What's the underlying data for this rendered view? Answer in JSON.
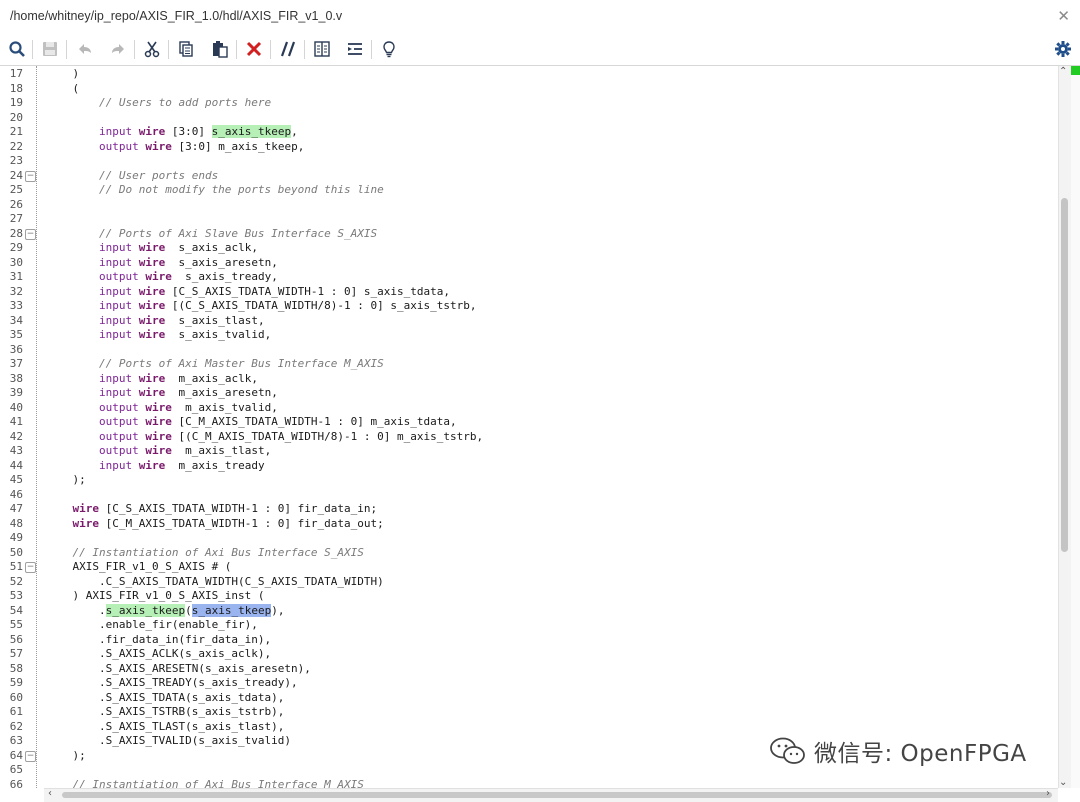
{
  "window": {
    "file_path": "/home/whitney/ip_repo/AXIS_FIR_1.0/hdl/AXIS_FIR_v1_0.v"
  },
  "toolbar": {
    "items": [
      {
        "name": "search-icon"
      },
      {
        "name": "save-icon"
      },
      {
        "name": "undo-icon"
      },
      {
        "name": "redo-icon"
      },
      {
        "name": "cut-icon"
      },
      {
        "name": "copy-icon"
      },
      {
        "name": "paste-icon"
      },
      {
        "name": "delete-icon"
      },
      {
        "name": "comment-icon"
      },
      {
        "name": "columns-icon"
      },
      {
        "name": "indent-icon"
      },
      {
        "name": "lightbulb-icon"
      },
      {
        "name": "gear-icon"
      }
    ]
  },
  "colors": {
    "keyword": "#7f2596",
    "comment": "#7a7a7a",
    "highlight": "#b6f0b6",
    "selection": "#9ab4f0",
    "marker": "#22cc22"
  },
  "editor": {
    "lines": [
      {
        "num": "17",
        "code": "    )"
      },
      {
        "num": "18",
        "code": "    ("
      },
      {
        "num": "19",
        "code": "        // Users to add ports here",
        "type": "comment"
      },
      {
        "num": "20",
        "code": ""
      },
      {
        "num": "21",
        "code": "        input wire [3:0] s_axis_tkeep,"
      },
      {
        "num": "22",
        "code": "        output wire [3:0] m_axis_tkeep,"
      },
      {
        "num": "23",
        "code": ""
      },
      {
        "num": "24",
        "code": "        // User ports ends",
        "type": "comment",
        "fold": true
      },
      {
        "num": "25",
        "code": "        // Do not modify the ports beyond this line",
        "type": "comment"
      },
      {
        "num": "26",
        "code": ""
      },
      {
        "num": "27",
        "code": ""
      },
      {
        "num": "28",
        "code": "        // Ports of Axi Slave Bus Interface S_AXIS",
        "type": "comment",
        "fold": true
      },
      {
        "num": "29",
        "code": "        input wire  s_axis_aclk,"
      },
      {
        "num": "30",
        "code": "        input wire  s_axis_aresetn,"
      },
      {
        "num": "31",
        "code": "        output wire  s_axis_tready,"
      },
      {
        "num": "32",
        "code": "        input wire [C_S_AXIS_TDATA_WIDTH-1 : 0] s_axis_tdata,"
      },
      {
        "num": "33",
        "code": "        input wire [(C_S_AXIS_TDATA_WIDTH/8)-1 : 0] s_axis_tstrb,"
      },
      {
        "num": "34",
        "code": "        input wire  s_axis_tlast,"
      },
      {
        "num": "35",
        "code": "        input wire  s_axis_tvalid,"
      },
      {
        "num": "36",
        "code": ""
      },
      {
        "num": "37",
        "code": "        // Ports of Axi Master Bus Interface M_AXIS",
        "type": "comment"
      },
      {
        "num": "38",
        "code": "        input wire  m_axis_aclk,"
      },
      {
        "num": "39",
        "code": "        input wire  m_axis_aresetn,"
      },
      {
        "num": "40",
        "code": "        output wire  m_axis_tvalid,"
      },
      {
        "num": "41",
        "code": "        output wire [C_M_AXIS_TDATA_WIDTH-1 : 0] m_axis_tdata,"
      },
      {
        "num": "42",
        "code": "        output wire [(C_M_AXIS_TDATA_WIDTH/8)-1 : 0] m_axis_tstrb,"
      },
      {
        "num": "43",
        "code": "        output wire  m_axis_tlast,"
      },
      {
        "num": "44",
        "code": "        input wire  m_axis_tready"
      },
      {
        "num": "45",
        "code": "    );"
      },
      {
        "num": "46",
        "code": ""
      },
      {
        "num": "47",
        "code": "    wire [C_S_AXIS_TDATA_WIDTH-1 : 0] fir_data_in;"
      },
      {
        "num": "48",
        "code": "    wire [C_M_AXIS_TDATA_WIDTH-1 : 0] fir_data_out;"
      },
      {
        "num": "49",
        "code": ""
      },
      {
        "num": "50",
        "code": "    // Instantiation of Axi Bus Interface S_AXIS",
        "type": "comment"
      },
      {
        "num": "51",
        "code": "    AXIS_FIR_v1_0_S_AXIS # (",
        "fold": true
      },
      {
        "num": "52",
        "code": "        .C_S_AXIS_TDATA_WIDTH(C_S_AXIS_TDATA_WIDTH)"
      },
      {
        "num": "53",
        "code": "    ) AXIS_FIR_v1_0_S_AXIS_inst ("
      },
      {
        "num": "54",
        "code": "        .s_axis_tkeep(s_axis_tkeep),"
      },
      {
        "num": "55",
        "code": "        .enable_fir(enable_fir),"
      },
      {
        "num": "56",
        "code": "        .fir_data_in(fir_data_in),"
      },
      {
        "num": "57",
        "code": "        .S_AXIS_ACLK(s_axis_aclk),"
      },
      {
        "num": "58",
        "code": "        .S_AXIS_ARESETN(s_axis_aresetn),"
      },
      {
        "num": "59",
        "code": "        .S_AXIS_TREADY(s_axis_tready),"
      },
      {
        "num": "60",
        "code": "        .S_AXIS_TDATA(s_axis_tdata),"
      },
      {
        "num": "61",
        "code": "        .S_AXIS_TSTRB(s_axis_tstrb),"
      },
      {
        "num": "62",
        "code": "        .S_AXIS_TLAST(s_axis_tlast),"
      },
      {
        "num": "63",
        "code": "        .S_AXIS_TVALID(s_axis_tvalid)"
      },
      {
        "num": "64",
        "code": "    );",
        "fold": true
      },
      {
        "num": "65",
        "code": ""
      },
      {
        "num": "66",
        "code": "    // Instantiation of Axi Bus Interface M_AXIS",
        "type": "comment"
      }
    ]
  },
  "watermark": {
    "text": "微信号: OpenFPGA"
  }
}
